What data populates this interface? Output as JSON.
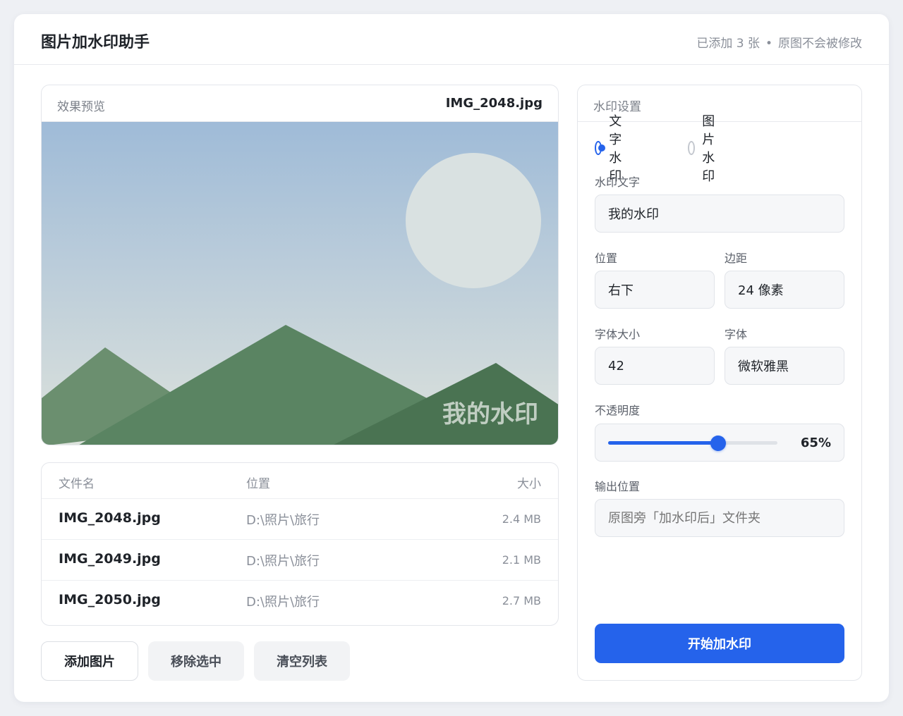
{
  "app": {
    "title": "图片加水印助手",
    "status_count": "已添加 3 张",
    "status_separator": "•",
    "status_note": "原图不会被修改"
  },
  "preview": {
    "title": "效果预览",
    "filename": "IMG_2048.jpg",
    "watermark_text": "我的水印",
    "colors": {
      "sky_top": "#9fbbd8",
      "sky_bottom": "#dde2dc",
      "sun": "#d9e1e1",
      "mountain_light": "#6b8f6f",
      "mountain_mid": "#5a8462",
      "mountain_dark": "#4a7352"
    }
  },
  "file_table": {
    "columns": {
      "name": "文件名",
      "location": "位置",
      "size": "大小"
    },
    "rows": [
      {
        "name": "IMG_2048.jpg",
        "location": "D:\\照片\\旅行",
        "size": "2.4 MB"
      },
      {
        "name": "IMG_2049.jpg",
        "location": "D:\\照片\\旅行",
        "size": "2.1 MB"
      },
      {
        "name": "IMG_2050.jpg",
        "location": "D:\\照片\\旅行",
        "size": "2.7 MB"
      }
    ]
  },
  "actions": {
    "add": "添加图片",
    "remove": "移除选中",
    "clear": "清空列表"
  },
  "settings": {
    "title": "水印设置",
    "type_text": "文字水印",
    "type_image": "图片水印",
    "type_selected": "text",
    "text_label": "水印文字",
    "text_value": "我的水印",
    "position_label": "位置",
    "position_value": "右下",
    "margin_label": "边距",
    "margin_value": "24 像素",
    "font_size_label": "字体大小",
    "font_size_value": "42",
    "font_label": "字体",
    "font_value": "微软雅黑",
    "opacity_label": "不透明度",
    "opacity_percent": 65,
    "opacity_display": "65%",
    "output_label": "输出位置",
    "output_placeholder": "原图旁「加水印后」文件夹",
    "start_button": "开始加水印",
    "accent_color": "#2563eb"
  }
}
